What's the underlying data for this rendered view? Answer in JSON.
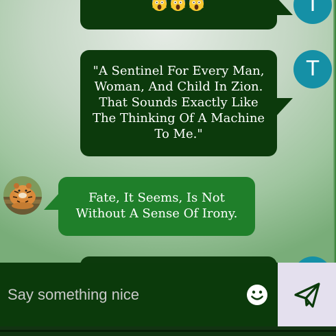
{
  "messages": [
    {
      "id": "m1",
      "sender": "T",
      "direction": "sent",
      "emoji": [
        "😱",
        "😱",
        "😱"
      ]
    },
    {
      "id": "m2",
      "sender": "T",
      "direction": "sent",
      "lines": [
        "\"A Sentinel For Every Man,",
        "Woman, And Child In Zion.",
        "That Sounds Exactly Like",
        "The Thinking Of A Machine",
        "To Me.\""
      ]
    },
    {
      "id": "m3",
      "direction": "received",
      "avatar": "tiger-avatar",
      "lines": [
        "Fate, It Seems, Is Not",
        "Without A Sense Of Irony."
      ]
    }
  ],
  "composer": {
    "placeholder": "Say something nice",
    "emoji_icon": "smiley-icon",
    "send_icon": "paper-plane-icon"
  },
  "colors": {
    "sent_bubble": "#0c3a0c",
    "received_bubble": "#1f7f2a",
    "avatar_t": "#1590a6",
    "composer_bg": "#0b3a0b",
    "send_bg": "#e4e0ee"
  }
}
